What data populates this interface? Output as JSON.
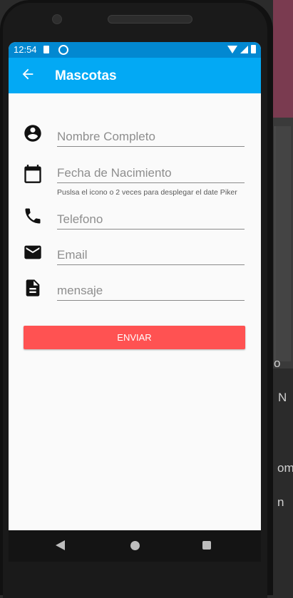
{
  "status_bar": {
    "time": "12:54"
  },
  "app_bar": {
    "title": "Mascotas"
  },
  "form": {
    "fields": [
      {
        "icon": "account-circle-icon",
        "placeholder": "Nombre Completo"
      },
      {
        "icon": "calendar-icon",
        "placeholder": "Fecha de Nacimiento"
      },
      {
        "icon": "phone-icon",
        "placeholder": "Telefono"
      },
      {
        "icon": "email-icon",
        "placeholder": "Email"
      },
      {
        "icon": "document-icon",
        "placeholder": "mensaje"
      }
    ],
    "date_helper": "Puslsa el icono o 2 veces para desplegar el date Piker",
    "submit_label": "ENVIAR"
  },
  "background_fragments": [
    "o",
    "N",
    "om",
    "n"
  ],
  "colors": {
    "status_bar": "#0288d1",
    "app_bar": "#03a9f4",
    "button": "#ff5252"
  }
}
